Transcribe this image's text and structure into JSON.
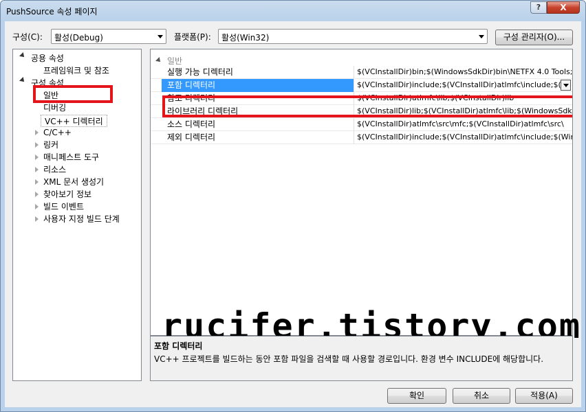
{
  "window": {
    "title": "PushSource 속성 페이지",
    "help": "?",
    "close": "X"
  },
  "toolbar": {
    "config_label": "구성(C):",
    "config_value": "활성(Debug)",
    "platform_label": "플랫폼(P):",
    "platform_value": "활성(Win32)",
    "config_manager": "구성 관리자(O)..."
  },
  "tree": {
    "common": "공용 속성",
    "framework": "프레임워크 및 참조",
    "config": "구성 속성",
    "children": [
      "일반",
      "디버깅",
      "VC++ 디렉터리",
      "C/C++",
      "링커",
      "매니페스트 도구",
      "리소스",
      "XML 문서 생성기",
      "찾아보기 정보",
      "빌드 이벤트",
      "사용자 지정 빌드 단계"
    ]
  },
  "grid": {
    "category": "일반",
    "rows": [
      {
        "name": "실행 가능 디렉터리",
        "value": "$(VCInstallDir)bin;$(WindowsSdkDir)bin\\NETFX 4.0 Tools;"
      },
      {
        "name": "포함 디렉터리",
        "value": "$(VCInstallDir)include;$(VCInstallDir)atlmfc\\include;$(W"
      },
      {
        "name": "참조 디렉터리",
        "value": "$(VCInstallDir)atlmfc\\lib;$(VCInstallDir)lib"
      },
      {
        "name": "라이브러리 디렉터리",
        "value": "$(VCInstallDir)lib;$(VCInstallDir)atlmfc\\lib;$(WindowsSdkD"
      },
      {
        "name": "소스 디렉터리",
        "value": "$(VCInstallDir)atlmfc\\src\\mfc;$(VCInstallDir)atlmfc\\src\\"
      },
      {
        "name": "제외 디렉터리",
        "value": "$(VCInstallDir)include;$(VCInstallDir)atlmfc\\include;$(Win"
      }
    ]
  },
  "watermark": "rucifer.tistory.com",
  "description": {
    "title": "포함 디렉터리",
    "text": "VC++ 프로젝트를 빌드하는 동안 포함 파일을 검색할 때 사용할 경로입니다. 환경 변수 INCLUDE에 해당합니다."
  },
  "buttons": {
    "ok": "확인",
    "cancel": "취소",
    "apply": "적용(A)"
  }
}
